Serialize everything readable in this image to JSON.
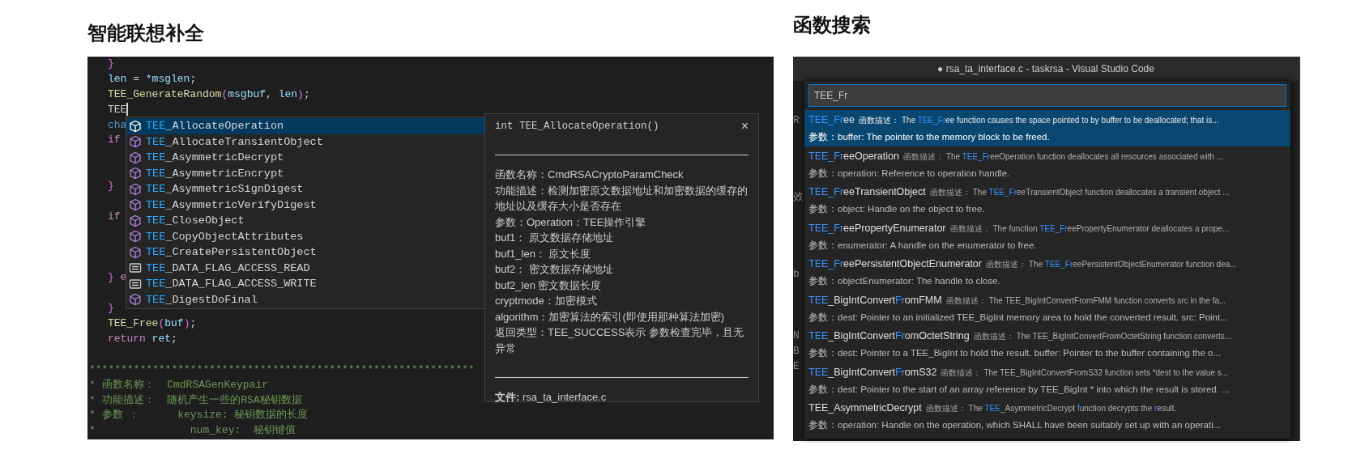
{
  "left": {
    "title": "智能联想补全",
    "code_lines": [
      {
        "kind": "code",
        "tokens": [
          {
            "kind": "bracket",
            "text": "}"
          }
        ]
      },
      {
        "kind": "code",
        "tokens": [
          {
            "kind": "variable",
            "text": "len"
          },
          {
            "kind": "plain",
            "text": " = "
          },
          {
            "kind": "variable",
            "text": "*msglen"
          },
          {
            "kind": "plain",
            "text": ";"
          }
        ]
      },
      {
        "kind": "code",
        "tokens": [
          {
            "kind": "function",
            "text": "TEE_GenerateRandom"
          },
          {
            "kind": "bracket",
            "text": "("
          },
          {
            "kind": "variable",
            "text": "msgbuf"
          },
          {
            "kind": "plain",
            "text": ", "
          },
          {
            "kind": "variable",
            "text": "len"
          },
          {
            "kind": "bracket",
            "text": ")"
          },
          {
            "kind": "plain",
            "text": ";"
          }
        ]
      },
      {
        "kind": "code",
        "cursor": true,
        "tokens": [
          {
            "kind": "plain",
            "text": "TEE"
          }
        ]
      },
      {
        "kind": "code",
        "tokens": [
          {
            "kind": "type",
            "text": "cha"
          }
        ]
      },
      {
        "kind": "code",
        "tokens": [
          {
            "kind": "keyword",
            "text": "if"
          }
        ]
      },
      {
        "kind": "blank"
      },
      {
        "kind": "blank"
      },
      {
        "kind": "code",
        "tokens": [
          {
            "kind": "bracket",
            "text": "}"
          }
        ]
      },
      {
        "kind": "blank"
      },
      {
        "kind": "code",
        "tokens": [
          {
            "kind": "keyword",
            "text": "if"
          }
        ]
      },
      {
        "kind": "blank"
      },
      {
        "kind": "blank"
      },
      {
        "kind": "blank"
      },
      {
        "kind": "code",
        "tokens": [
          {
            "kind": "bracket",
            "text": "}"
          },
          {
            "kind": "keyword",
            "text": " e"
          }
        ]
      },
      {
        "kind": "blank"
      },
      {
        "kind": "code",
        "tokens": [
          {
            "kind": "bracket",
            "text": "}"
          }
        ]
      },
      {
        "kind": "code",
        "tokens": [
          {
            "kind": "function",
            "text": "TEE_Free"
          },
          {
            "kind": "bracket",
            "text": "("
          },
          {
            "kind": "variable",
            "text": "buf"
          },
          {
            "kind": "bracket",
            "text": ")"
          },
          {
            "kind": "plain",
            "text": ";"
          }
        ]
      },
      {
        "kind": "code",
        "tokens": [
          {
            "kind": "keyword",
            "text": "return "
          },
          {
            "kind": "variable",
            "text": "ret"
          },
          {
            "kind": "plain",
            "text": ";"
          }
        ]
      },
      {
        "kind": "blank"
      },
      {
        "kind": "comment",
        "tokens": [
          {
            "kind": "comment",
            "text": "*************************************************************"
          }
        ]
      },
      {
        "kind": "comment",
        "tokens": [
          {
            "kind": "comment",
            "text": "* 函数名称：  CmdRSAGenKeypair"
          }
        ]
      },
      {
        "kind": "comment",
        "tokens": [
          {
            "kind": "comment",
            "text": "* 功能描述：  随机产生一些的RSA秘钥数据"
          }
        ]
      },
      {
        "kind": "comment",
        "tokens": [
          {
            "kind": "comment",
            "text": "* 参数 ：      keysize: 秘钥数据的长度"
          }
        ]
      },
      {
        "kind": "comment",
        "tokens": [
          {
            "kind": "comment",
            "text": "*               num_key:  秘钥键值"
          }
        ]
      }
    ],
    "suggestions": [
      {
        "kind": "method",
        "match": "TEE",
        "rest": "_AllocateOperation",
        "selected": true
      },
      {
        "kind": "method",
        "match": "TEE",
        "rest": "_AllocateTransientObject",
        "selected": false
      },
      {
        "kind": "method",
        "match": "TEE",
        "rest": "_AsymmetricDecrypt",
        "selected": false
      },
      {
        "kind": "method",
        "match": "TEE",
        "rest": "_AsymmetricEncrypt",
        "selected": false
      },
      {
        "kind": "method",
        "match": "TEE",
        "rest": "_AsymmetricSignDigest",
        "selected": false
      },
      {
        "kind": "method",
        "match": "TEE",
        "rest": "_AsymmetricVerifyDigest",
        "selected": false
      },
      {
        "kind": "method",
        "match": "TEE",
        "rest": "_CloseObject",
        "selected": false
      },
      {
        "kind": "method",
        "match": "TEE",
        "rest": "_CopyObjectAttributes",
        "selected": false
      },
      {
        "kind": "method",
        "match": "TEE",
        "rest": "_CreatePersistentObject",
        "selected": false
      },
      {
        "kind": "field",
        "match": "TEE",
        "rest": "_DATA_FLAG_ACCESS_READ",
        "selected": false
      },
      {
        "kind": "field",
        "match": "TEE",
        "rest": "_DATA_FLAG_ACCESS_WRITE",
        "selected": false
      },
      {
        "kind": "method",
        "match": "TEE",
        "rest": "_DigestDoFinal",
        "selected": false
      }
    ],
    "details": {
      "signature": "int TEE_AllocateOperation()",
      "close": "×",
      "lines": [
        "函数名称：CmdRSACryptoParamCheck",
        "功能描述：检测加密原文数据地址和加密数据的缓存的地址以及缓存大小是否存在",
        "参数：Operation：TEE操作引擎",
        "buf1：  原文数据存储地址",
        "buf1_len：  原文长度",
        "buf2：  密文数据存储地址",
        "buf2_len 密文数据长度",
        "cryptmode：加密模式",
        "algorithm：加密算法的索引(即使用那种算法加密)",
        "返回类型：TEE_SUCCESS表示 参数检查完毕，且无异常"
      ],
      "file": "**文件:** rsa_ta_interface.c"
    }
  },
  "right": {
    "title": "函数搜索",
    "window_title": "● rsa_ta_interface.c - taskrsa - Visual Studio Code",
    "gutter": [
      {
        "kind": "text",
        "text": "R"
      },
      {
        "kind": "blank"
      },
      {
        "kind": "blank"
      },
      {
        "kind": "blank"
      },
      {
        "kind": "blank"
      },
      {
        "kind": "text",
        "text": "效"
      },
      {
        "kind": "blank"
      },
      {
        "kind": "blank"
      },
      {
        "kind": "blank"
      },
      {
        "kind": "blank"
      },
      {
        "kind": "text",
        "text": "b"
      },
      {
        "kind": "blank"
      },
      {
        "kind": "blank"
      },
      {
        "kind": "blank"
      },
      {
        "kind": "text",
        "text": "N"
      },
      {
        "kind": "text",
        "text": "B"
      },
      {
        "kind": "text",
        "text": "E"
      }
    ],
    "search": {
      "value": "TEE_Fr"
    },
    "results": [
      {
        "selected": true,
        "name": [
          {
            "text": "TEE_Fr",
            "match": true
          },
          {
            "text": "ee",
            "match": false
          }
        ],
        "desc_label": "函数描述：",
        "desc": [
          {
            "text": "The ",
            "match": false
          },
          {
            "text": "TEE_Fr",
            "match": true
          },
          {
            "text": "ee function causes the space pointed to by buffer to be deallocated; that is...",
            "match": false
          }
        ],
        "params": "参数：buffer: The pointer to the memory block to be freed."
      },
      {
        "selected": false,
        "name": [
          {
            "text": "TEE_Fr",
            "match": true
          },
          {
            "text": "eeOperation",
            "match": false
          }
        ],
        "desc_label": "函数描述：",
        "desc": [
          {
            "text": "The ",
            "match": false
          },
          {
            "text": "TEE_Fr",
            "match": true
          },
          {
            "text": "eeOperation function deallocates all resources associated with ...",
            "match": false
          }
        ],
        "params": "参数：operation: Reference to operation handle."
      },
      {
        "selected": false,
        "name": [
          {
            "text": "TEE_Fr",
            "match": true
          },
          {
            "text": "eeTransientObject",
            "match": false
          }
        ],
        "desc_label": "函数描述：",
        "desc": [
          {
            "text": "The ",
            "match": false
          },
          {
            "text": "TEE_Fr",
            "match": true
          },
          {
            "text": "eeTransientObject function deallocates a transient object ...",
            "match": false
          }
        ],
        "params": "参数：object: Handle on the object to free."
      },
      {
        "selected": false,
        "name": [
          {
            "text": "TEE_Fr",
            "match": true
          },
          {
            "text": "eePropertyEnumerator",
            "match": false
          }
        ],
        "desc_label": "函数描述：",
        "desc": [
          {
            "text": "The function ",
            "match": false
          },
          {
            "text": "TEE_Fr",
            "match": true
          },
          {
            "text": "eePropertyEnumerator deallocates a prope...",
            "match": false
          }
        ],
        "params": "参数：enumerator: A handle on the enumerator to free."
      },
      {
        "selected": false,
        "name": [
          {
            "text": "TEE_Fr",
            "match": true
          },
          {
            "text": "eePersistentObjectEnumerator",
            "match": false
          }
        ],
        "desc_label": "函数描述：",
        "desc": [
          {
            "text": "The ",
            "match": false
          },
          {
            "text": "TEE_Fr",
            "match": true
          },
          {
            "text": "eePersistentObjectEnumerator function dea...",
            "match": false
          }
        ],
        "params": "参数：objectEnumerator: The handle to close."
      },
      {
        "selected": false,
        "name": [
          {
            "text": "TEE",
            "match": true
          },
          {
            "text": "_BigIntConvert",
            "match": false
          },
          {
            "text": "Fr",
            "match": true
          },
          {
            "text": "omFMM",
            "match": false
          }
        ],
        "desc_label": "函数描述：",
        "desc": [
          {
            "text": "The TEE_BigIntConvertFromFMM function converts src in the fa...",
            "match": false
          }
        ],
        "params": "参数：dest: Pointer to an initialized TEE_BigInt memory area to hold the converted result. src: Point..."
      },
      {
        "selected": false,
        "name": [
          {
            "text": "TEE",
            "match": true
          },
          {
            "text": "_BigIntConvert",
            "match": false
          },
          {
            "text": "Fr",
            "match": true
          },
          {
            "text": "omOctetString",
            "match": false
          }
        ],
        "desc_label": "函数描述：",
        "desc": [
          {
            "text": "The TEE_BigIntConvertFromOctetString function converts...",
            "match": false
          }
        ],
        "params": "参数：dest: Pointer to a TEE_BigInt to hold the result. buffer: Pointer to the buffer containing the o..."
      },
      {
        "selected": false,
        "name": [
          {
            "text": "TEE",
            "match": true
          },
          {
            "text": "_BigIntConvert",
            "match": false
          },
          {
            "text": "Fr",
            "match": true
          },
          {
            "text": "omS32",
            "match": false
          }
        ],
        "desc_label": "函数描述：",
        "desc": [
          {
            "text": "The TEE_BigIntConvertFromS32 function sets *dest to the value s...",
            "match": false
          }
        ],
        "params": "参数：dest: Pointer to the start of an array reference by TEE_BigInt * into which the result is stored. ..."
      },
      {
        "selected": false,
        "name": [
          {
            "text": "TEE_AsymmetricDecrypt",
            "match": false
          }
        ],
        "desc_label": "函数描述：",
        "desc": [
          {
            "text": "The ",
            "match": false
          },
          {
            "text": "TEE",
            "match": true
          },
          {
            "text": "_AsymmetricDecrypt ",
            "match": false
          },
          {
            "text": "f",
            "match": true
          },
          {
            "text": "unction decrypts the ",
            "match": false
          },
          {
            "text": "r",
            "match": true
          },
          {
            "text": "esult.",
            "match": false
          }
        ],
        "params": "参数：operation: Handle on the operation, which SHALL have been suitably set up with an operati..."
      }
    ]
  }
}
